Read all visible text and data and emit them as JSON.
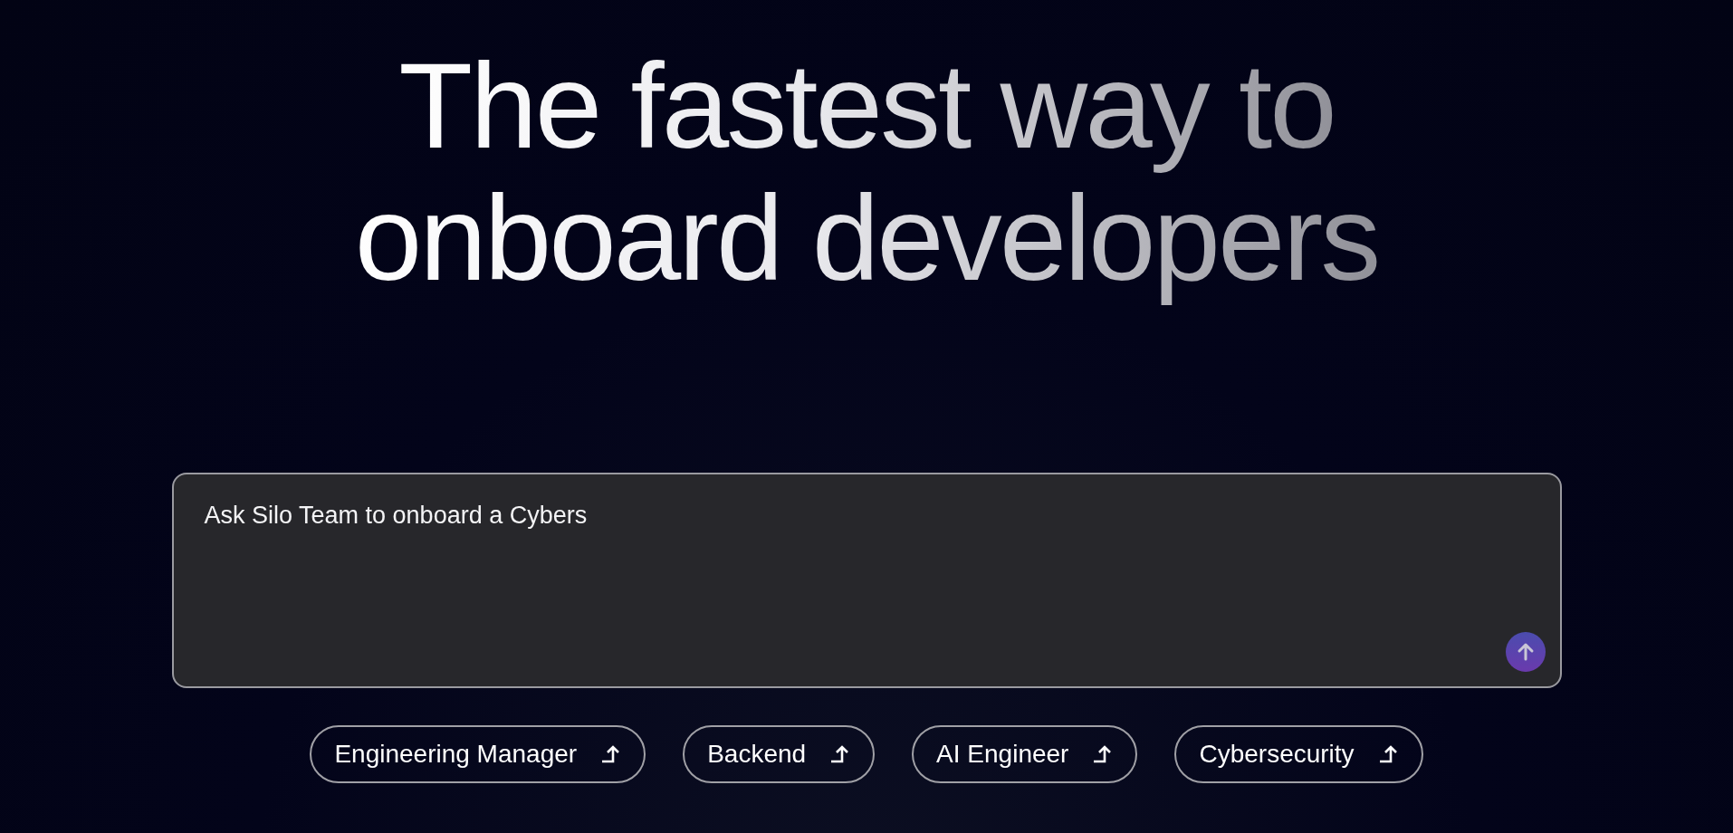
{
  "hero": {
    "title_lines": [
      "The fastest way to",
      "onboard developers"
    ]
  },
  "prompt": {
    "value": "Ask Silo Team to onboard a Cybers"
  },
  "suggestions": [
    {
      "label": "Engineering Manager"
    },
    {
      "label": "Backend"
    },
    {
      "label": "AI Engineer"
    },
    {
      "label": "Cybersecurity"
    }
  ]
}
